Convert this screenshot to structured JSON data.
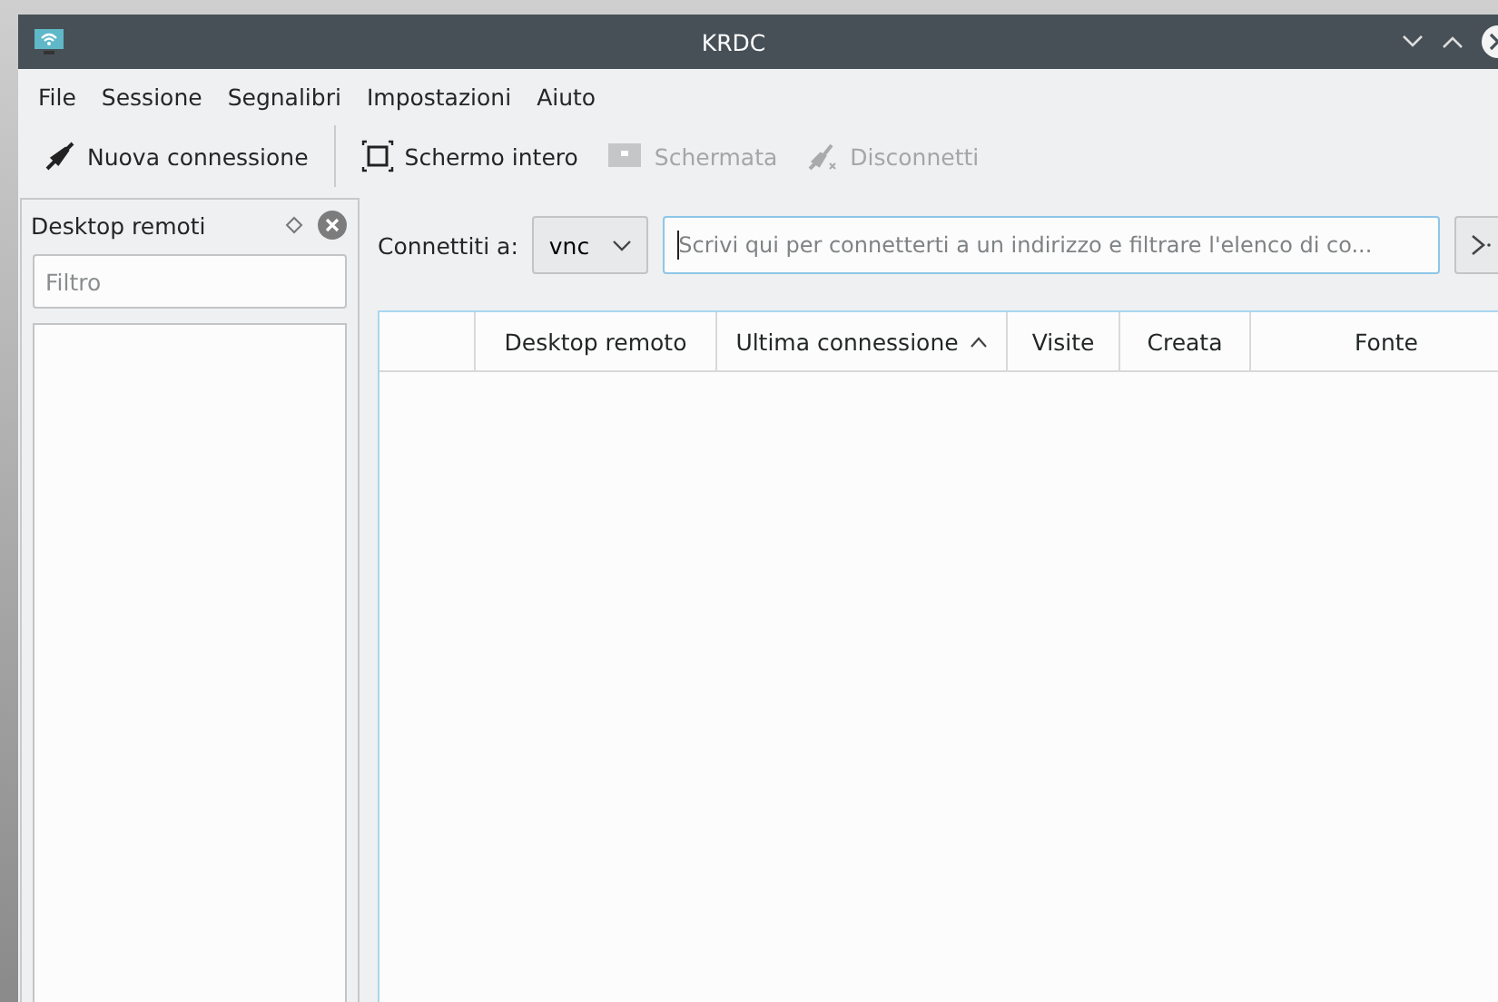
{
  "window": {
    "title": "KRDC"
  },
  "menu": [
    "File",
    "Sessione",
    "Segnalibri",
    "Impostazioni",
    "Aiuto"
  ],
  "toolbar": [
    {
      "kind": "plug",
      "label": "Nuova connessione",
      "disabled": false
    },
    {
      "kind": "fullscreen",
      "label": "Schermo intero",
      "disabled": false
    },
    {
      "kind": "screenshot",
      "label": "Schermata",
      "disabled": true
    },
    {
      "kind": "unplug",
      "label": "Disconnetti",
      "disabled": true
    }
  ],
  "dock": {
    "title": "Desktop remoti",
    "filter": {
      "placeholder": "Filtro"
    }
  },
  "connect": {
    "label": "Connettiti a:",
    "protocol": "vnc",
    "address": {
      "placeholder": "Scrivi qui per connetterti a un indirizzo e filtrare l'elenco di co..."
    }
  },
  "table": {
    "columns": [
      {
        "label": "Desktop remoto",
        "sorted": false
      },
      {
        "label": "Ultima connessione",
        "sorted": true
      },
      {
        "label": "Visite",
        "sorted": false
      },
      {
        "label": "Creata",
        "sorted": false
      },
      {
        "label": "Fonte",
        "sorted": false
      }
    ]
  }
}
